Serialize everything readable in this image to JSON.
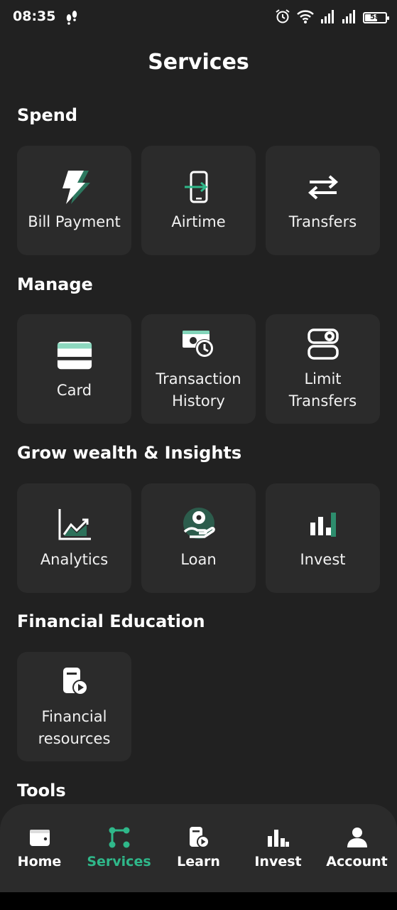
{
  "status_bar": {
    "time": "08:35",
    "battery": "58"
  },
  "page": {
    "title": "Services"
  },
  "sections": {
    "spend": {
      "title": "Spend",
      "items": [
        {
          "label": "Bill Payment",
          "icon": "lightning-icon"
        },
        {
          "label": "Airtime",
          "icon": "phone-icon"
        },
        {
          "label": "Transfers",
          "icon": "arrows-swap-icon"
        }
      ]
    },
    "manage": {
      "title": "Manage",
      "items": [
        {
          "label": "Card",
          "icon": "card-icon"
        },
        {
          "label": "Transaction History",
          "line1": "Transaction",
          "line2": "History",
          "icon": "money-clock-icon"
        },
        {
          "label": "Limit Transfers",
          "line1": "Limit",
          "line2": "Transfers",
          "icon": "toggle-icon"
        }
      ]
    },
    "grow": {
      "title": "Grow wealth & Insights",
      "items": [
        {
          "label": "Analytics",
          "icon": "chart-up-icon"
        },
        {
          "label": "Loan",
          "icon": "hand-coin-icon"
        },
        {
          "label": "Invest",
          "icon": "bar-chart-icon"
        }
      ]
    },
    "education": {
      "title": "Financial Education",
      "items": [
        {
          "label": "Financial resources",
          "line1": "Financial",
          "line2": "resources",
          "icon": "document-play-icon"
        }
      ]
    },
    "tools": {
      "title": "Tools"
    }
  },
  "bottom_nav": {
    "items": [
      {
        "label": "Home",
        "icon": "wallet-icon"
      },
      {
        "label": "Services",
        "icon": "nodes-icon",
        "active": true
      },
      {
        "label": "Learn",
        "icon": "document-play-icon"
      },
      {
        "label": "Invest",
        "icon": "bar-chart-icon"
      },
      {
        "label": "Account",
        "icon": "user-icon"
      }
    ]
  },
  "colors": {
    "background": "#212121",
    "tile": "#2b2b2b",
    "accent": "#2fb88a"
  }
}
